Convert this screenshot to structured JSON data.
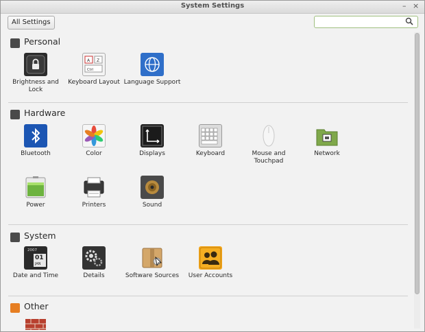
{
  "window": {
    "title": "System Settings",
    "minimize": "–",
    "close": "×"
  },
  "toolbar": {
    "all_settings": "All Settings",
    "search_placeholder": ""
  },
  "sections": {
    "personal": {
      "title": "Personal",
      "items": [
        {
          "label": "Brightness and Lock",
          "icon": "brightness-lock-icon",
          "color": "#2c2c2c"
        },
        {
          "label": "Keyboard Layout",
          "icon": "keyboard-layout-icon",
          "color": "#f4f4f4"
        },
        {
          "label": "Language Support",
          "icon": "language-support-icon",
          "color": "#2f6fc9"
        }
      ]
    },
    "hardware": {
      "title": "Hardware",
      "items": [
        {
          "label": "Bluetooth",
          "icon": "bluetooth-icon",
          "color": "#1c56b3"
        },
        {
          "label": "Color",
          "icon": "color-icon",
          "color": "#f6f6f6"
        },
        {
          "label": "Displays",
          "icon": "displays-icon",
          "color": "#222222"
        },
        {
          "label": "Keyboard",
          "icon": "keyboard-icon",
          "color": "#dcdcdc"
        },
        {
          "label": "Mouse and Touchpad",
          "icon": "mouse-touchpad-icon",
          "color": "#f0f0f0"
        },
        {
          "label": "Network",
          "icon": "network-icon",
          "color": "#6e9a3c"
        },
        {
          "label": "Power",
          "icon": "power-icon",
          "color": "#6db33f"
        },
        {
          "label": "Printers",
          "icon": "printers-icon",
          "color": "#3a3a3a"
        },
        {
          "label": "Sound",
          "icon": "sound-icon",
          "color": "#4a4a4a"
        }
      ]
    },
    "system": {
      "title": "System",
      "items": [
        {
          "label": "Date and Time",
          "icon": "date-time-icon",
          "color": "#2a2a2a",
          "calendar": {
            "year": "2007",
            "day": "01",
            "month": "JAN"
          }
        },
        {
          "label": "Details",
          "icon": "details-icon",
          "color": "#333333"
        },
        {
          "label": "Software Sources",
          "icon": "software-sources-icon",
          "color": "#c79a5e"
        },
        {
          "label": "User Accounts",
          "icon": "user-accounts-icon",
          "color": "#f2a51a"
        }
      ]
    },
    "other": {
      "title": "Other",
      "items": [
        {
          "label": "",
          "icon": "firewall-icon",
          "color": "#c0392b"
        }
      ]
    }
  },
  "colors": {
    "personal_accent": "#4a4a4a",
    "hardware_accent": "#4a4a4a",
    "system_accent": "#4a4a4a",
    "other_accent": "#e67e22",
    "search_border": "#9fbf7f"
  }
}
